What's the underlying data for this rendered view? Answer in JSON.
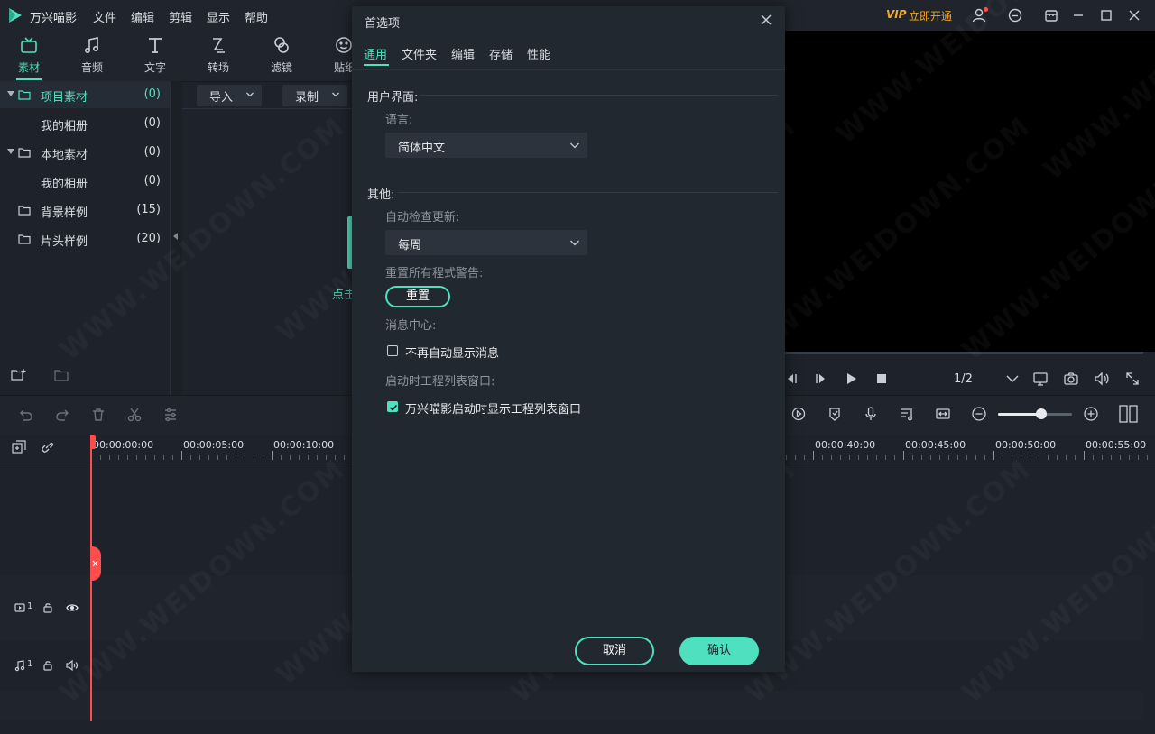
{
  "app": {
    "name": "万兴喵影",
    "menu": [
      "文件",
      "编辑",
      "剪辑",
      "显示",
      "帮助"
    ],
    "vip_badge": "VIP",
    "vip_action": "立即开通",
    "brand_color": "#4fe0c0"
  },
  "tool_tabs": [
    {
      "label": "素材",
      "icon": "media-icon",
      "active": true
    },
    {
      "label": "音频",
      "icon": "music-icon"
    },
    {
      "label": "文字",
      "icon": "text-icon"
    },
    {
      "label": "转场",
      "icon": "transition-icon"
    },
    {
      "label": "滤镜",
      "icon": "filter-icon"
    },
    {
      "label": "贴纸",
      "icon": "sticker-icon"
    }
  ],
  "sidebar": {
    "items": [
      {
        "label": "项目素材",
        "count": "(0)",
        "expandable": true,
        "selected": true
      },
      {
        "label": "我的相册",
        "count": "(0)"
      },
      {
        "label": "本地素材",
        "count": "(0)",
        "expandable": true
      },
      {
        "label": "我的相册",
        "count": "(0)"
      },
      {
        "label": "背景样例",
        "count": "(15)"
      },
      {
        "label": "片头样例",
        "count": "(20)"
      }
    ]
  },
  "media": {
    "import_label": "导入",
    "record_label": "录制",
    "hint": "点击"
  },
  "ruler": {
    "left_labels": [
      "00:00:00:00",
      "00:00:05:00",
      "00:00:10:00"
    ],
    "right_labels": [
      "00:00:40:00",
      "00:00:45:00",
      "00:00:50:00",
      "00:00:55:00"
    ]
  },
  "tracks": {
    "video_track": "1",
    "audio_track": "1"
  },
  "preview": {
    "page_counter": "1/2",
    "zoom_level": 0.58
  },
  "dialog": {
    "title": "首选项",
    "tabs": [
      "通用",
      "文件夹",
      "编辑",
      "存储",
      "性能"
    ],
    "active_tab": 0,
    "section_ui": "用户界面:",
    "language_label": "语言:",
    "language_value": "简体中文",
    "section_other": "其他:",
    "auto_update_label": "自动检查更新:",
    "auto_update_value": "每周",
    "reset_warnings_label": "重置所有程式警告:",
    "reset_button": "重置",
    "message_center_label": "消息中心:",
    "no_auto_message": "不再自动显示消息",
    "no_auto_message_checked": false,
    "startup_project_label": "启动时工程列表窗口:",
    "startup_project_option": "万兴喵影启动时显示工程列表窗口",
    "startup_project_checked": true,
    "cancel": "取消",
    "ok": "确认"
  },
  "watermark": "WWW.WEIDOWN.COM"
}
